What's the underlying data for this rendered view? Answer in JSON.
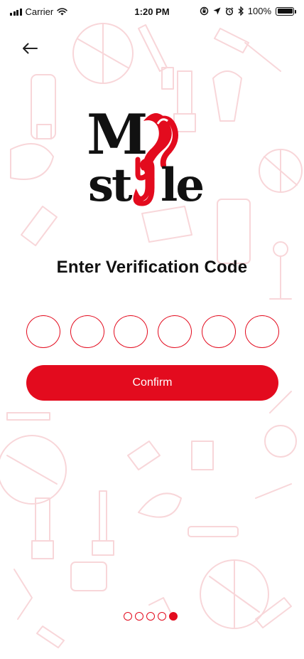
{
  "status_bar": {
    "carrier": "Carrier",
    "time": "1:20 PM",
    "battery_percent": "100%",
    "signal_bars": 4,
    "icons": [
      "wifi-icon",
      "screen-rotation-lock-icon",
      "location-arrow-icon",
      "alarm-icon",
      "bluetooth-icon",
      "battery-icon"
    ]
  },
  "header": {
    "back_icon": "arrow-left-icon"
  },
  "logo": {
    "line1": "MY",
    "line2": "Style"
  },
  "verification": {
    "title": "Enter Verification Code",
    "code_length": 6,
    "digits": [
      "",
      "",
      "",
      "",
      "",
      ""
    ]
  },
  "actions": {
    "confirm_label": "Confirm"
  },
  "pager": {
    "total": 5,
    "active_index": 4
  },
  "colors": {
    "accent": "#e30b1e",
    "background": "#ffffff",
    "text": "#111111",
    "pattern": "#f6c9cd"
  }
}
